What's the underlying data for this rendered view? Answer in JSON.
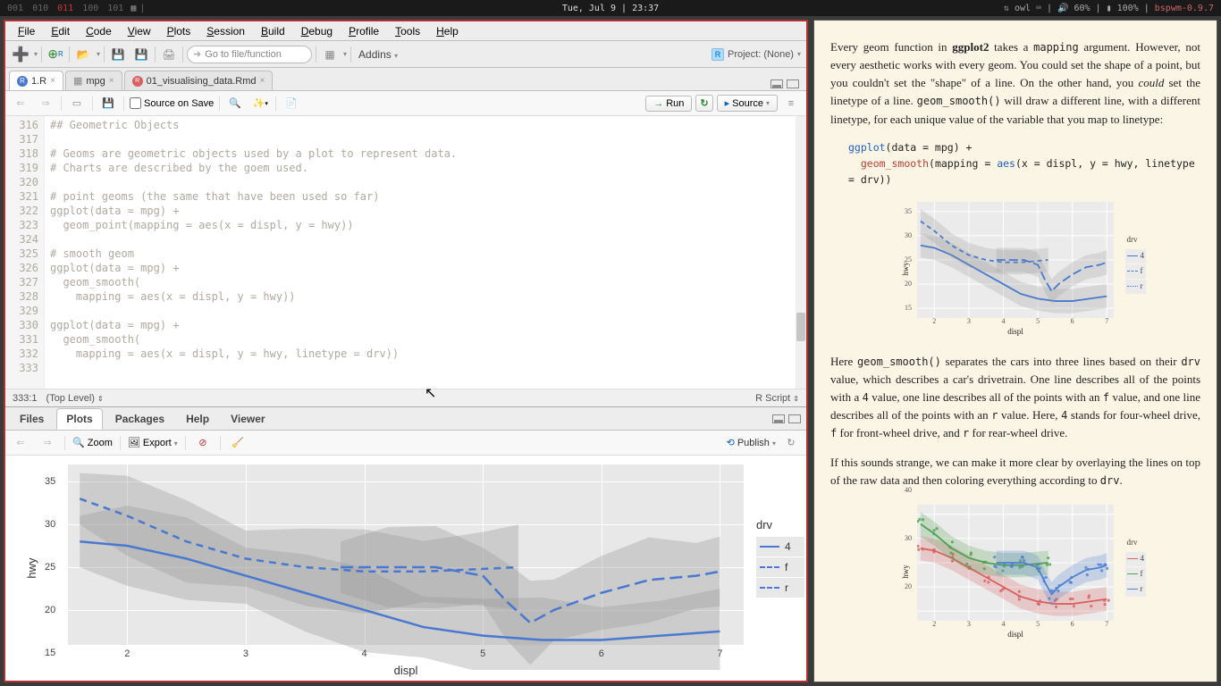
{
  "topbar": {
    "workspaces": [
      "001",
      "010",
      "011",
      "100",
      "101"
    ],
    "active_ws": 2,
    "datetime": "Tue, Jul 9  |  23:37",
    "user": "owl",
    "volume": "60%",
    "battery": "100%",
    "wm": "bspwm-0.9.7"
  },
  "menu": [
    "File",
    "Edit",
    "Code",
    "View",
    "Plots",
    "Session",
    "Build",
    "Debug",
    "Profile",
    "Tools",
    "Help"
  ],
  "toolbar": {
    "gotofile_placeholder": "Go to file/function",
    "addins_label": "Addins",
    "project_label": "Project: (None)"
  },
  "tabs": [
    {
      "icon": "r",
      "label": "1.R",
      "active": true
    },
    {
      "icon": "grid",
      "label": "mpg",
      "active": false
    },
    {
      "icon": "rmd",
      "label": "01_visualising_data.Rmd",
      "active": false
    }
  ],
  "src_toolbar": {
    "source_on_save": "Source on Save",
    "run": "Run",
    "source": "Source"
  },
  "editor": {
    "first_line": 316,
    "lines": [
      "## Geometric Objects",
      "",
      "# Geoms are geometric objects used by a plot to represent data.",
      "# Charts are described by the goem used.",
      "",
      "# point geoms (the same that have been used so far)",
      "ggplot(data = mpg) +",
      "  geom_point(mapping = aes(x = displ, y = hwy))",
      "",
      "# smooth geom",
      "ggplot(data = mpg) +",
      "  geom_smooth(",
      "    mapping = aes(x = displ, y = hwy))",
      "",
      "ggplot(data = mpg) +",
      "  geom_smooth(",
      "    mapping = aes(x = displ, y = hwy, linetype = drv))",
      ""
    ]
  },
  "status": {
    "pos": "333:1",
    "scope": "(Top Level)",
    "lang": "R Script"
  },
  "panel_tabs": [
    "Files",
    "Plots",
    "Packages",
    "Help",
    "Viewer"
  ],
  "panel_active": 1,
  "plot_toolbar": {
    "zoom": "Zoom",
    "export": "Export",
    "publish": "Publish"
  },
  "chart_data": {
    "type": "line",
    "xlabel": "displ",
    "ylabel": "hwy",
    "xlim": [
      1.5,
      7.2
    ],
    "ylim": [
      13,
      37
    ],
    "x_ticks": [
      2,
      3,
      4,
      5,
      6,
      7
    ],
    "y_ticks": [
      15,
      20,
      25,
      30,
      35
    ],
    "legend_title": "drv",
    "series": [
      {
        "name": "4",
        "linetype": "solid",
        "x": [
          1.6,
          2,
          2.5,
          3,
          3.5,
          4,
          4.5,
          5,
          5.5,
          6,
          6.5,
          7
        ],
        "y": [
          28,
          27.5,
          26,
          24,
          22,
          20,
          18,
          17,
          16.5,
          16.5,
          17,
          17.5
        ]
      },
      {
        "name": "f",
        "linetype": "dashed",
        "x": [
          1.6,
          2,
          2.5,
          3,
          3.5,
          4,
          4.5,
          5,
          5.3
        ],
        "y": [
          33,
          31,
          28,
          26,
          25,
          24.5,
          24.5,
          24.8,
          25
        ]
      },
      {
        "name": "r",
        "linetype": "longdash",
        "x": [
          3.8,
          4.2,
          4.6,
          5,
          5.2,
          5.4,
          5.6,
          6,
          6.4,
          6.8,
          7
        ],
        "y": [
          25,
          25,
          25,
          24,
          21,
          18.5,
          20,
          22,
          23.5,
          24,
          24.5
        ]
      }
    ]
  },
  "reader": {
    "p1_pre": "Every geom function in ",
    "p1_b1": "ggplot2",
    "p1_mid1": " takes a ",
    "p1_c1": "mapping",
    "p1_mid2": " argument. However, not every aesthetic works with every geom. You could set the shape of a point, but you couldn't set the \"shape\" of a line. On the other hand, you ",
    "p1_i1": "could",
    "p1_mid3": " set the linetype of a line. ",
    "p1_c2": "geom_smooth()",
    "p1_end": " will draw a different line, with a different linetype, for each unique value of the variable that you map to linetype:",
    "code1_l1a": "ggplot",
    "code1_l1b": "(data = mpg) +",
    "code1_l2a": "geom_smooth",
    "code1_l2b": "(mapping = ",
    "code1_l2c": "aes",
    "code1_l2d": "(x = displ, y = hwy, linetype = drv))",
    "p2_pre": "Here ",
    "p2_c1": "geom_smooth()",
    "p2_mid1": " separates the cars into three lines based on their ",
    "p2_c2": "drv",
    "p2_mid2": " value, which describes a car's drivetrain. One line describes all of the points with a ",
    "p2_c3": "4",
    "p2_mid3": " value, one line describes all of the points with an ",
    "p2_c4": "f",
    "p2_mid4": " value, and one line describes all of the points with an ",
    "p2_c5": "r",
    "p2_mid5": " value. Here, ",
    "p2_c6": "4",
    "p2_mid6": " stands for four-wheel drive, ",
    "p2_c7": "f",
    "p2_mid7": " for front-wheel drive, and ",
    "p2_c8": "r",
    "p2_end": " for rear-wheel drive.",
    "p3_pre": "If this sounds strange, we can make it more clear by overlaying the lines on top of the raw data and then coloring everything according to ",
    "p3_c1": "drv",
    "p3_end": ".",
    "mini_legend_title": "drv",
    "mini_legend": [
      "4",
      "f",
      "r"
    ],
    "mini_xlabel": "displ",
    "mini_ylabel": "hwy",
    "mini_xticks": [
      "2",
      "3",
      "4",
      "5",
      "6",
      "7"
    ],
    "mini_yticks": [
      "15",
      "20",
      "25",
      "30",
      "35"
    ],
    "mini2_yticks": [
      "20",
      "30",
      "40"
    ]
  }
}
